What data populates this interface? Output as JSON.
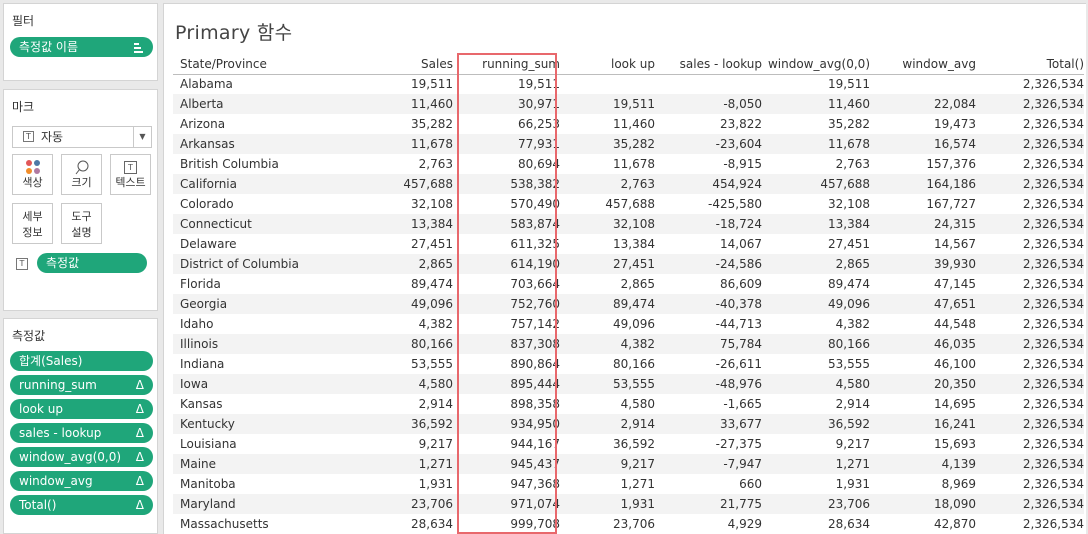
{
  "sidebar": {
    "filters": {
      "title": "필터",
      "pill": "측정값 이름"
    },
    "marks": {
      "title": "마크",
      "mark_type": "자동",
      "buttons": {
        "color": "색상",
        "size": "크기",
        "text": "텍스트",
        "detail": "세부\n정보",
        "tooltip": "도구\n설명"
      },
      "text_pill": "측정값"
    },
    "measures": {
      "title": "측정값",
      "pills": [
        {
          "label": "합계(Sales)",
          "delta": ""
        },
        {
          "label": "running_sum",
          "delta": "Δ"
        },
        {
          "label": "look up",
          "delta": "Δ"
        },
        {
          "label": "sales - lookup",
          "delta": "Δ"
        },
        {
          "label": "window_avg(0,0)",
          "delta": "Δ"
        },
        {
          "label": "window_avg",
          "delta": "Δ"
        },
        {
          "label": "Total()",
          "delta": "Δ"
        }
      ]
    }
  },
  "view": {
    "title": "Primary 함수",
    "columns": [
      "State/Province",
      "Sales",
      "running_sum",
      "look up",
      "sales - lookup",
      "window_avg(0,0)",
      "window_avg",
      "Total()"
    ],
    "rows": [
      [
        "Alabama",
        "19,511",
        "19,511",
        "",
        "",
        "19,511",
        "",
        "2,326,534"
      ],
      [
        "Alberta",
        "11,460",
        "30,971",
        "19,511",
        "-8,050",
        "11,460",
        "22,084",
        "2,326,534"
      ],
      [
        "Arizona",
        "35,282",
        "66,253",
        "11,460",
        "23,822",
        "35,282",
        "19,473",
        "2,326,534"
      ],
      [
        "Arkansas",
        "11,678",
        "77,931",
        "35,282",
        "-23,604",
        "11,678",
        "16,574",
        "2,326,534"
      ],
      [
        "British Columbia",
        "2,763",
        "80,694",
        "11,678",
        "-8,915",
        "2,763",
        "157,376",
        "2,326,534"
      ],
      [
        "California",
        "457,688",
        "538,382",
        "2,763",
        "454,924",
        "457,688",
        "164,186",
        "2,326,534"
      ],
      [
        "Colorado",
        "32,108",
        "570,490",
        "457,688",
        "-425,580",
        "32,108",
        "167,727",
        "2,326,534"
      ],
      [
        "Connecticut",
        "13,384",
        "583,874",
        "32,108",
        "-18,724",
        "13,384",
        "24,315",
        "2,326,534"
      ],
      [
        "Delaware",
        "27,451",
        "611,325",
        "13,384",
        "14,067",
        "27,451",
        "14,567",
        "2,326,534"
      ],
      [
        "District of Columbia",
        "2,865",
        "614,190",
        "27,451",
        "-24,586",
        "2,865",
        "39,930",
        "2,326,534"
      ],
      [
        "Florida",
        "89,474",
        "703,664",
        "2,865",
        "86,609",
        "89,474",
        "47,145",
        "2,326,534"
      ],
      [
        "Georgia",
        "49,096",
        "752,760",
        "89,474",
        "-40,378",
        "49,096",
        "47,651",
        "2,326,534"
      ],
      [
        "Idaho",
        "4,382",
        "757,142",
        "49,096",
        "-44,713",
        "4,382",
        "44,548",
        "2,326,534"
      ],
      [
        "Illinois",
        "80,166",
        "837,308",
        "4,382",
        "75,784",
        "80,166",
        "46,035",
        "2,326,534"
      ],
      [
        "Indiana",
        "53,555",
        "890,864",
        "80,166",
        "-26,611",
        "53,555",
        "46,100",
        "2,326,534"
      ],
      [
        "Iowa",
        "4,580",
        "895,444",
        "53,555",
        "-48,976",
        "4,580",
        "20,350",
        "2,326,534"
      ],
      [
        "Kansas",
        "2,914",
        "898,358",
        "4,580",
        "-1,665",
        "2,914",
        "14,695",
        "2,326,534"
      ],
      [
        "Kentucky",
        "36,592",
        "934,950",
        "2,914",
        "33,677",
        "36,592",
        "16,241",
        "2,326,534"
      ],
      [
        "Louisiana",
        "9,217",
        "944,167",
        "36,592",
        "-27,375",
        "9,217",
        "15,693",
        "2,326,534"
      ],
      [
        "Maine",
        "1,271",
        "945,437",
        "9,217",
        "-7,947",
        "1,271",
        "4,139",
        "2,326,534"
      ],
      [
        "Manitoba",
        "1,931",
        "947,368",
        "1,271",
        "660",
        "1,931",
        "8,969",
        "2,326,534"
      ],
      [
        "Maryland",
        "23,706",
        "971,074",
        "1,931",
        "21,775",
        "23,706",
        "18,090",
        "2,326,534"
      ],
      [
        "Massachusetts",
        "28,634",
        "999,708",
        "23,706",
        "4,929",
        "28,634",
        "42,870",
        "2,326,534"
      ]
    ]
  },
  "colors": {
    "pill": "#1fa67a",
    "highlight": "#e8686c"
  }
}
